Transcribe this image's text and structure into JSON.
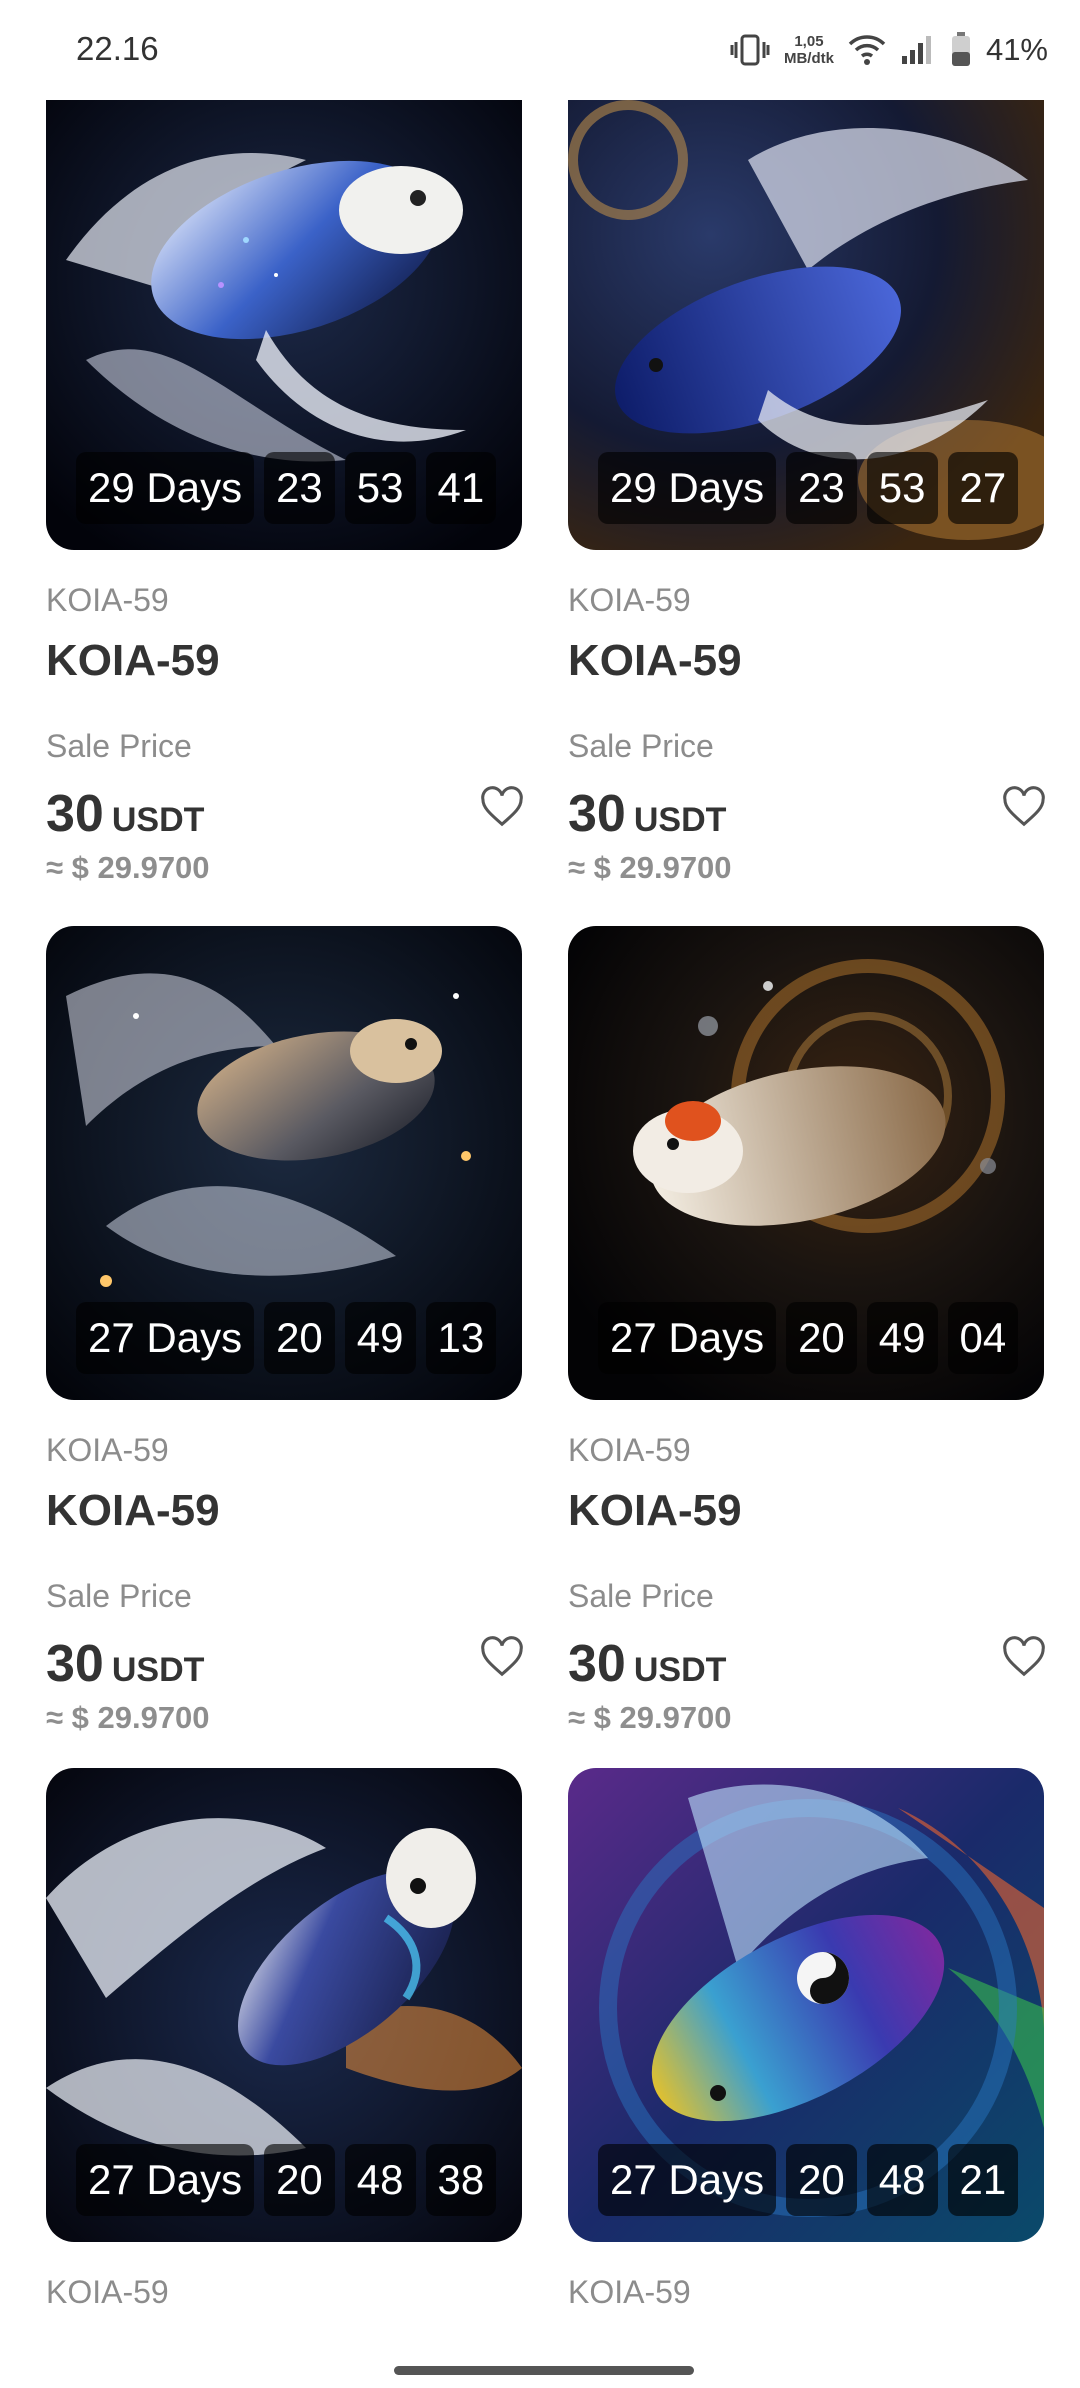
{
  "status_bar": {
    "time": "22.16",
    "speed_value": "1,05",
    "speed_unit": "MB/dtk",
    "battery_percent": "41%"
  },
  "cards": [
    {
      "collection": "KOIA-59",
      "name": "KOIA-59",
      "price_label": "Sale Price",
      "price": "30",
      "currency": "USDT",
      "approx": "≈ $ 29.9700",
      "timer": {
        "days": "29 Days",
        "hours": "23",
        "minutes": "53",
        "seconds": "41"
      }
    },
    {
      "collection": "KOIA-59",
      "name": "KOIA-59",
      "price_label": "Sale Price",
      "price": "30",
      "currency": "USDT",
      "approx": "≈ $ 29.9700",
      "timer": {
        "days": "29 Days",
        "hours": "23",
        "minutes": "53",
        "seconds": "27"
      }
    },
    {
      "collection": "KOIA-59",
      "name": "KOIA-59",
      "price_label": "Sale Price",
      "price": "30",
      "currency": "USDT",
      "approx": "≈ $ 29.9700",
      "timer": {
        "days": "27 Days",
        "hours": "20",
        "minutes": "49",
        "seconds": "13"
      }
    },
    {
      "collection": "KOIA-59",
      "name": "KOIA-59",
      "price_label": "Sale Price",
      "price": "30",
      "currency": "USDT",
      "approx": "≈ $ 29.9700",
      "timer": {
        "days": "27 Days",
        "hours": "20",
        "minutes": "49",
        "seconds": "04"
      }
    },
    {
      "collection": "KOIA-59",
      "timer": {
        "days": "27 Days",
        "hours": "20",
        "minutes": "48",
        "seconds": "38"
      }
    },
    {
      "collection": "KOIA-59",
      "timer": {
        "days": "27 Days",
        "hours": "20",
        "minutes": "48",
        "seconds": "21"
      }
    }
  ],
  "colors": {
    "text_primary": "#333333",
    "text_secondary": "#8c8c8c",
    "card_art_bg": "#05060c"
  }
}
